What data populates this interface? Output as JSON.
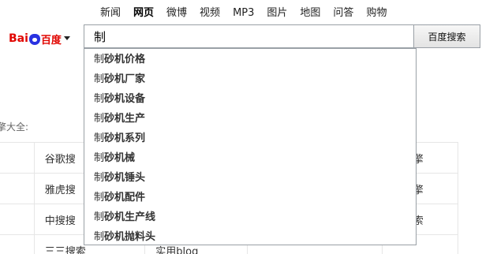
{
  "nav": {
    "items": [
      {
        "label": "新闻",
        "active": false
      },
      {
        "label": "网页",
        "active": true
      },
      {
        "label": "微博",
        "active": false
      },
      {
        "label": "视频",
        "active": false
      },
      {
        "label": "MP3",
        "active": false
      },
      {
        "label": "图片",
        "active": false
      },
      {
        "label": "地图",
        "active": false
      },
      {
        "label": "问答",
        "active": false
      },
      {
        "label": "购物",
        "active": false
      }
    ]
  },
  "logo": {
    "text_left": "Bai",
    "text_right": "百度",
    "icon": "paw-du-icon",
    "dropdown_icon": "caret-down-icon",
    "colors": {
      "red": "#e10601",
      "blue": "#2932e1"
    }
  },
  "search": {
    "value": "制",
    "button_label": "百度搜索"
  },
  "suggestions": [
    {
      "typed": "制",
      "rest": "砂机价格"
    },
    {
      "typed": "制",
      "rest": "砂机厂家"
    },
    {
      "typed": "制",
      "rest": "砂机设备"
    },
    {
      "typed": "制",
      "rest": "砂机生产"
    },
    {
      "typed": "制",
      "rest": "砂机系列"
    },
    {
      "typed": "制",
      "rest": "砂机械"
    },
    {
      "typed": "制",
      "rest": "砂机锤头"
    },
    {
      "typed": "制",
      "rest": "砂机配件"
    },
    {
      "typed": "制",
      "rest": "砂机生产线"
    },
    {
      "typed": "制",
      "rest": "砂机抛料头"
    }
  ],
  "background": {
    "section_label": "擎大全:",
    "rows": [
      [
        "擎",
        "谷歌搜",
        "",
        "",
        "索引擎"
      ],
      [
        "擎",
        "雅虎搜",
        "",
        "",
        "索引擎"
      ],
      [
        "擎",
        "中搜搜",
        "",
        "",
        "闻搜索"
      ],
      [
        "",
        "三三搜索",
        "实用blog",
        "",
        ""
      ]
    ]
  }
}
